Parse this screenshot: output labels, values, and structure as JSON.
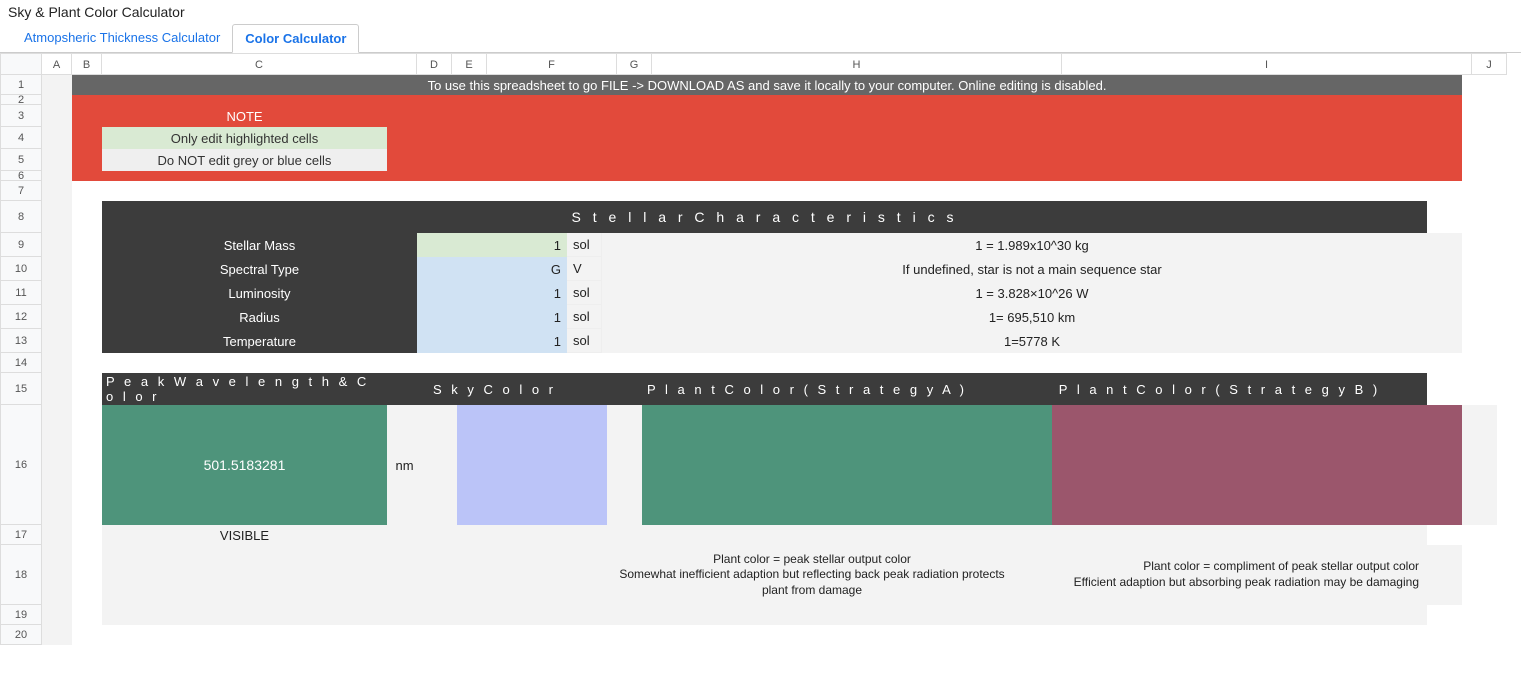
{
  "title": "Sky & Plant Color Calculator",
  "tabs": [
    {
      "label": "Atmopsheric Thickness Calculator",
      "active": false
    },
    {
      "label": "Color Calculator",
      "active": true
    }
  ],
  "columns": [
    "A",
    "B",
    "C",
    "D",
    "E",
    "F",
    "G",
    "H",
    "I",
    "J"
  ],
  "rows": [
    "1",
    "2",
    "3",
    "4",
    "5",
    "6",
    "7",
    "8",
    "9",
    "10",
    "11",
    "12",
    "13",
    "14",
    "15",
    "16",
    "17",
    "18",
    "19",
    "20"
  ],
  "banner": "To use this spreadsheet to go FILE -> DOWNLOAD AS and save it locally to your computer. Online editing is disabled.",
  "note": {
    "title": "NOTE",
    "line1": "Only edit highlighted cells",
    "line2": "Do NOT edit grey or blue cells"
  },
  "stellar": {
    "title": "S t e l l a r C h a r a c t e r i s t i c s",
    "rows": [
      {
        "label": "Stellar Mass",
        "value": "1",
        "unit": "sol",
        "desc": "1 = 1.989x10^30 kg",
        "cls": "input-green"
      },
      {
        "label": "Spectral Type",
        "value": "G",
        "unit": "V",
        "desc": "If undefined, star is not a main sequence star",
        "cls": "input-blue"
      },
      {
        "label": "Luminosity",
        "value": "1",
        "unit": "sol",
        "desc": "1 = 3.828×10^26 W",
        "cls": "input-blue"
      },
      {
        "label": "Radius",
        "value": "1",
        "unit": "sol",
        "desc": "1= 695,510 km",
        "cls": "input-blue"
      },
      {
        "label": "Temperature",
        "value": "1",
        "unit": "sol",
        "desc": "1=5778 K",
        "cls": "input-blue"
      }
    ]
  },
  "color_headers": {
    "peak": "P e a k W a v e l e n g t h & C o l o r",
    "sky": "S k y C o l o r",
    "plantA": "P l a n t C o l o r ( S t r a t e g y A )",
    "plantB": "P l a n t C o l o r ( S t r a t e g y B )"
  },
  "peak": {
    "value": "501.5183281",
    "unit": "nm",
    "visible": "VISIBLE"
  },
  "plantA_desc": "Plant color = peak stellar output color\nSomewhat inefficient adaption but reflecting back peak radiation protects plant from damage",
  "plantB_desc": "Plant color = compliment of peak stellar output color\nEfficient adaption but absorbing peak radiation may be damaging",
  "colors": {
    "peak": "#4e947b",
    "sky": "#bbc4f8",
    "plantA": "#4e947b",
    "plantB": "#9b566c"
  }
}
